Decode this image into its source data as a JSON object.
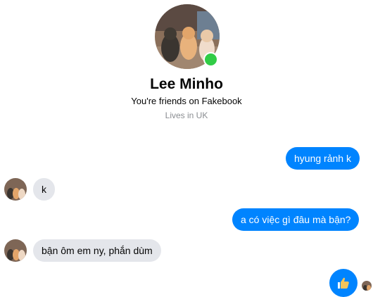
{
  "profile": {
    "name": "Lee Minho",
    "friend_status": "You're friends on Fakebook",
    "location": "Lives in UK",
    "avatar_icon": "cats-photo-icon",
    "online": true
  },
  "messages": [
    {
      "from": "me",
      "text": "hyung rảnh k"
    },
    {
      "from": "them",
      "text": "k"
    },
    {
      "from": "me",
      "text": "a có việc gì đâu mà bận?"
    },
    {
      "from": "them",
      "text": "bận ôm em ny, phắn dùm"
    },
    {
      "from": "me",
      "type": "like",
      "icon": "thumbs-up-icon"
    }
  ],
  "colors": {
    "outgoing": "#0084ff",
    "incoming": "#e4e6eb",
    "online": "#31cc46"
  }
}
